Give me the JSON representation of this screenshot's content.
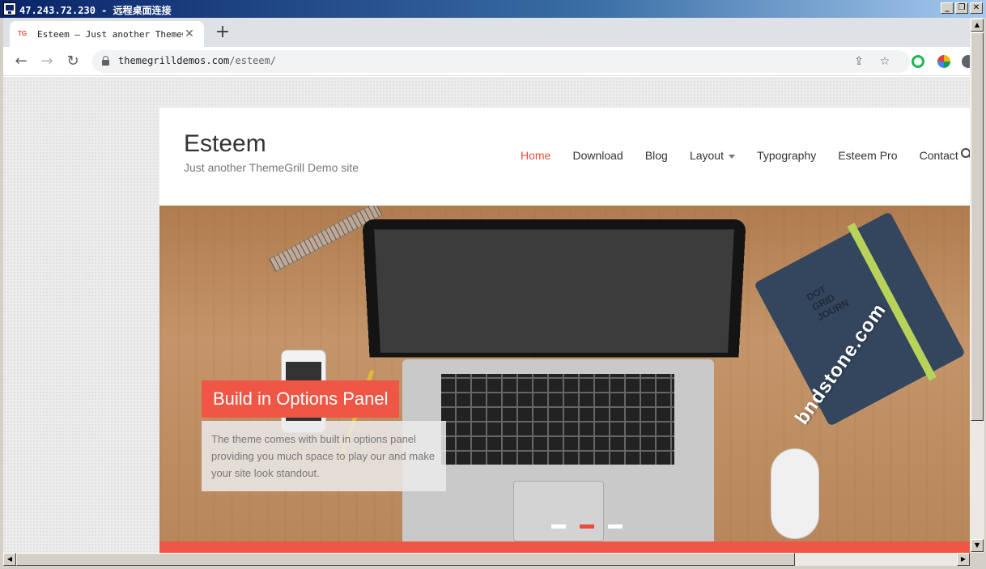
{
  "rdp": {
    "title": "47.243.72.230 - 远程桌面连接",
    "minimize_icon": "minimize-icon",
    "restore_icon": "restore-icon",
    "close_icon": "close-icon",
    "minimize_glyph": "_",
    "restore_glyph": "❐",
    "close_glyph": "✕"
  },
  "browser": {
    "tab": {
      "favicon": "TG",
      "title": "Esteem – Just another ThemeGrill Demo site",
      "close_glyph": "✕"
    },
    "new_tab_glyph": "+",
    "back_glyph": "←",
    "forward_glyph": "→",
    "reload_glyph": "↻",
    "url_host": "themegrilldemos.com",
    "url_path": "/esteem/",
    "share_glyph": "⇪",
    "bookmark_glyph": "☆"
  },
  "site": {
    "title": "Esteem",
    "tagline": "Just another ThemeGrill Demo site",
    "nav": [
      {
        "label": "Home",
        "active": true
      },
      {
        "label": "Download"
      },
      {
        "label": "Blog"
      },
      {
        "label": "Layout",
        "has_dropdown": true
      },
      {
        "label": "Typography"
      },
      {
        "label": "Esteem Pro"
      },
      {
        "label": "Contact"
      }
    ],
    "accent_color": "#e74c3c"
  },
  "slider": {
    "title": "Build in Options Panel",
    "description": "The theme comes with built in options panel providing you much space to play our and make your site look standout.",
    "notebook_label_1": "DOT",
    "notebook_label_2": "GRID",
    "notebook_label_3": "JOURN",
    "slide_count": 3,
    "active_slide": 2
  },
  "watermark": "bndstone.com",
  "scrollbar": {
    "up_glyph": "▲",
    "down_glyph": "▼",
    "left_glyph": "◀",
    "right_glyph": "▶"
  }
}
